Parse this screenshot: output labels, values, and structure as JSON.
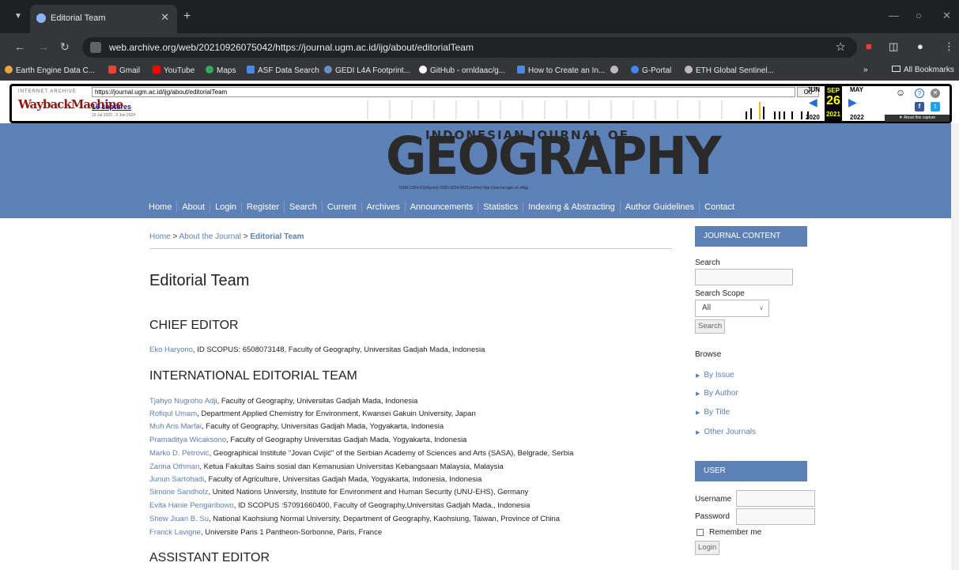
{
  "browser": {
    "tab_title": "Editorial Team",
    "url": "web.archive.org/web/20210926075042/https://journal.ugm.ac.id/ijg/about/editorialTeam",
    "bookmarks": [
      "Earth Engine Data C...",
      "Gmail",
      "YouTube",
      "Maps",
      "ASF Data Search",
      "GEDI L4A Footprint...",
      "GitHub - ornldaac/g...",
      "How to Create an In...",
      "G-Portal",
      "ETH Global Sentinel..."
    ],
    "all_bookmarks": "All Bookmarks",
    "colors": {
      "frame": "#1f2023",
      "toolbar": "#35363a"
    }
  },
  "wayback": {
    "ia_label": "INTERNET ARCHIVE",
    "logo": "WaybackMachine",
    "url": "https://journal.ugm.ac.id/ijg/about/editorialTeam",
    "go": "Go",
    "captures": "16 captures",
    "range": "19 Jul 2020 - 3 Jun 2024",
    "prev_month": "JUN",
    "cur_month": "SEP",
    "next_month": "MAY",
    "cur_day": "26",
    "prev_year": "2020",
    "cur_year": "2021",
    "next_year": "2022",
    "about": "▼ About this capture"
  },
  "site": {
    "logo_small": "INDONESIAN JOURNAL OF",
    "logo_big": "GEOGRAPHY",
    "issn": "ISSN 2354-9114(print)   ISSN 0024-9521(online)   http://journal.ugm.ac.id/ijg",
    "nav": [
      "Home",
      "About",
      "Login",
      "Register",
      "Search",
      "Current",
      "Archives",
      "Announcements",
      "Statistics",
      "Indexing & Abstracting",
      "Author Guidelines",
      "Contact"
    ],
    "accent": "#5d80b6"
  },
  "breadcrumb": {
    "home": "Home",
    "about": "About the Journal",
    "current": "Editorial Team",
    "sep": ">"
  },
  "page_title": "Editorial Team",
  "chief": {
    "heading": "CHIEF EDITOR",
    "entries": [
      {
        "name": "Eko Haryono",
        "rest": ", ID SCOPUS: 6508073148, Faculty of Geography, Universitas Gadjah Mada, Indonesia"
      }
    ]
  },
  "international": {
    "heading": "INTERNATIONAL EDITORIAL TEAM",
    "entries": [
      {
        "name": "Tjahyo Nugroho Adji",
        "rest": ", Faculty of Geography, Universitas Gadjah Mada, Indonesia"
      },
      {
        "name": "Rofiqul Umam",
        "rest": ", Department Applied Chemistry for Environment, Kwansei Gakuin University, Japan"
      },
      {
        "name": "Muh Aris Marfai",
        "rest": ", Faculty of Geography, Universitas Gadjah Mada, Yogyakarta, Indonesia"
      },
      {
        "name": "Pramaditya Wicaksono",
        "rest": ", Faculty of Geography Universitas Gadjah Mada, Yogyakarta, Indonesia"
      },
      {
        "name": "Marko D. Petrović",
        "rest": ", Geographical Institute \"Jovan Cvijić\" of the Serbian Academy of Sciences and Arts (SASA), Belgrade, Serbia"
      },
      {
        "name": "Zarina Othman",
        "rest": ", Ketua Fakultas Sains sosial dan Kemanusian Universitas Kebangsaan Malaysia, Malaysia"
      },
      {
        "name": "Junun Sartohadi",
        "rest": ", Faculty of Agriculture, Universitas Gadjah Mada, Yogyakarta, Indonesia, Indonesia"
      },
      {
        "name": "Simone Sandholz",
        "rest": ", United Nations University, Institute for Environment and Human Security (UNU-EHS), Germany"
      },
      {
        "name": "Evita Hanie Pengaribowo",
        "rest": ", ID SCOPUS :57091660400, Faculty of Geography,Universitas Gadjah Mada,, Indonesia"
      },
      {
        "name": "Shew Jiuan B. Su",
        "rest": ", National Kaohsiung Normal University, Department of Geography, Kaohsiung, Taiwan, Province of China"
      },
      {
        "name": "Franck Lavigne",
        "rest": ", Universite Paris 1 Pantheon-Sorbonne, Paris, France"
      }
    ]
  },
  "assistant": {
    "heading": "ASSISTANT EDITOR"
  },
  "sidebar": {
    "journal_content": "JOURNAL CONTENT",
    "search_label": "Search",
    "scope_label": "Search Scope",
    "scope_value": "All",
    "search_button": "Search",
    "browse_label": "Browse",
    "browse_links": [
      "By Issue",
      "By Author",
      "By Title",
      "Other Journals"
    ],
    "user": "USER",
    "username_label": "Username",
    "password_label": "Password",
    "remember_label": "Remember me",
    "login_button": "Login"
  }
}
